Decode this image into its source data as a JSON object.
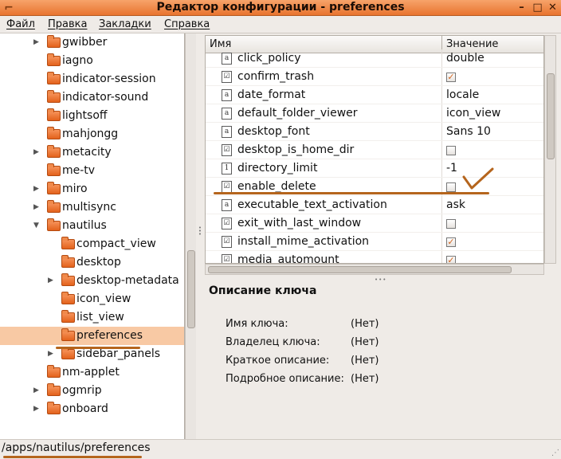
{
  "window": {
    "title": "Редактор конфигурации - preferences",
    "buttons": {
      "minimize": "–",
      "maximize": "□",
      "close": "✕"
    }
  },
  "menu": [
    "Файл",
    "Правка",
    "Закладки",
    "Справка"
  ],
  "tree": {
    "items": [
      {
        "label": "gwibber",
        "expander": "▶",
        "indent": 0
      },
      {
        "label": "iagno",
        "expander": "",
        "indent": 0
      },
      {
        "label": "indicator-session",
        "expander": "",
        "indent": 0
      },
      {
        "label": "indicator-sound",
        "expander": "",
        "indent": 0
      },
      {
        "label": "lightsoff",
        "expander": "",
        "indent": 0
      },
      {
        "label": "mahjongg",
        "expander": "",
        "indent": 0
      },
      {
        "label": "metacity",
        "expander": "▶",
        "indent": 0
      },
      {
        "label": "me-tv",
        "expander": "",
        "indent": 0
      },
      {
        "label": "miro",
        "expander": "▶",
        "indent": 0
      },
      {
        "label": "multisync",
        "expander": "▶",
        "indent": 0
      },
      {
        "label": "nautilus",
        "expander": "▼",
        "indent": 0
      },
      {
        "label": "compact_view",
        "expander": "",
        "indent": 1
      },
      {
        "label": "desktop",
        "expander": "",
        "indent": 1
      },
      {
        "label": "desktop-metadata",
        "expander": "▶",
        "indent": 1
      },
      {
        "label": "icon_view",
        "expander": "",
        "indent": 1
      },
      {
        "label": "list_view",
        "expander": "",
        "indent": 1
      },
      {
        "label": "preferences",
        "expander": "",
        "indent": 1,
        "selected": true
      },
      {
        "label": "sidebar_panels",
        "expander": "▶",
        "indent": 1
      },
      {
        "label": "nm-applet",
        "expander": "",
        "indent": 0
      },
      {
        "label": "ogmrip",
        "expander": "▶",
        "indent": 0
      },
      {
        "label": "onboard",
        "expander": "▶",
        "indent": 0
      }
    ]
  },
  "keys": {
    "headers": {
      "name": "Имя",
      "value": "Значение"
    },
    "rows": [
      {
        "name": "click_policy",
        "type": "string",
        "value": "double"
      },
      {
        "name": "confirm_trash",
        "type": "bool",
        "checked": true
      },
      {
        "name": "date_format",
        "type": "string",
        "value": "locale"
      },
      {
        "name": "default_folder_viewer",
        "type": "string",
        "value": "icon_view"
      },
      {
        "name": "desktop_font",
        "type": "string",
        "value": "Sans 10"
      },
      {
        "name": "desktop_is_home_dir",
        "type": "bool",
        "checked": false
      },
      {
        "name": "directory_limit",
        "type": "int",
        "value": "-1"
      },
      {
        "name": "enable_delete",
        "type": "bool",
        "checked": false
      },
      {
        "name": "executable_text_activation",
        "type": "string",
        "value": "ask"
      },
      {
        "name": "exit_with_last_window",
        "type": "bool",
        "checked": false
      },
      {
        "name": "install_mime_activation",
        "type": "bool",
        "checked": true
      },
      {
        "name": "media_automount",
        "type": "bool",
        "checked": true
      }
    ]
  },
  "description": {
    "title": "Описание ключа",
    "fields": [
      {
        "label": "Имя ключа:",
        "value": "(Нет)"
      },
      {
        "label": "Владелец ключа:",
        "value": "(Нет)"
      },
      {
        "label": "Краткое описание:",
        "value": "(Нет)"
      },
      {
        "label": "Подробное описание:",
        "value": "(Нет)"
      }
    ]
  },
  "status": {
    "path": "/apps/nautilus/preferences"
  },
  "colors": {
    "accent": "#e8742f",
    "selection": "#f8c9a4",
    "annotation": "#b5651d"
  }
}
